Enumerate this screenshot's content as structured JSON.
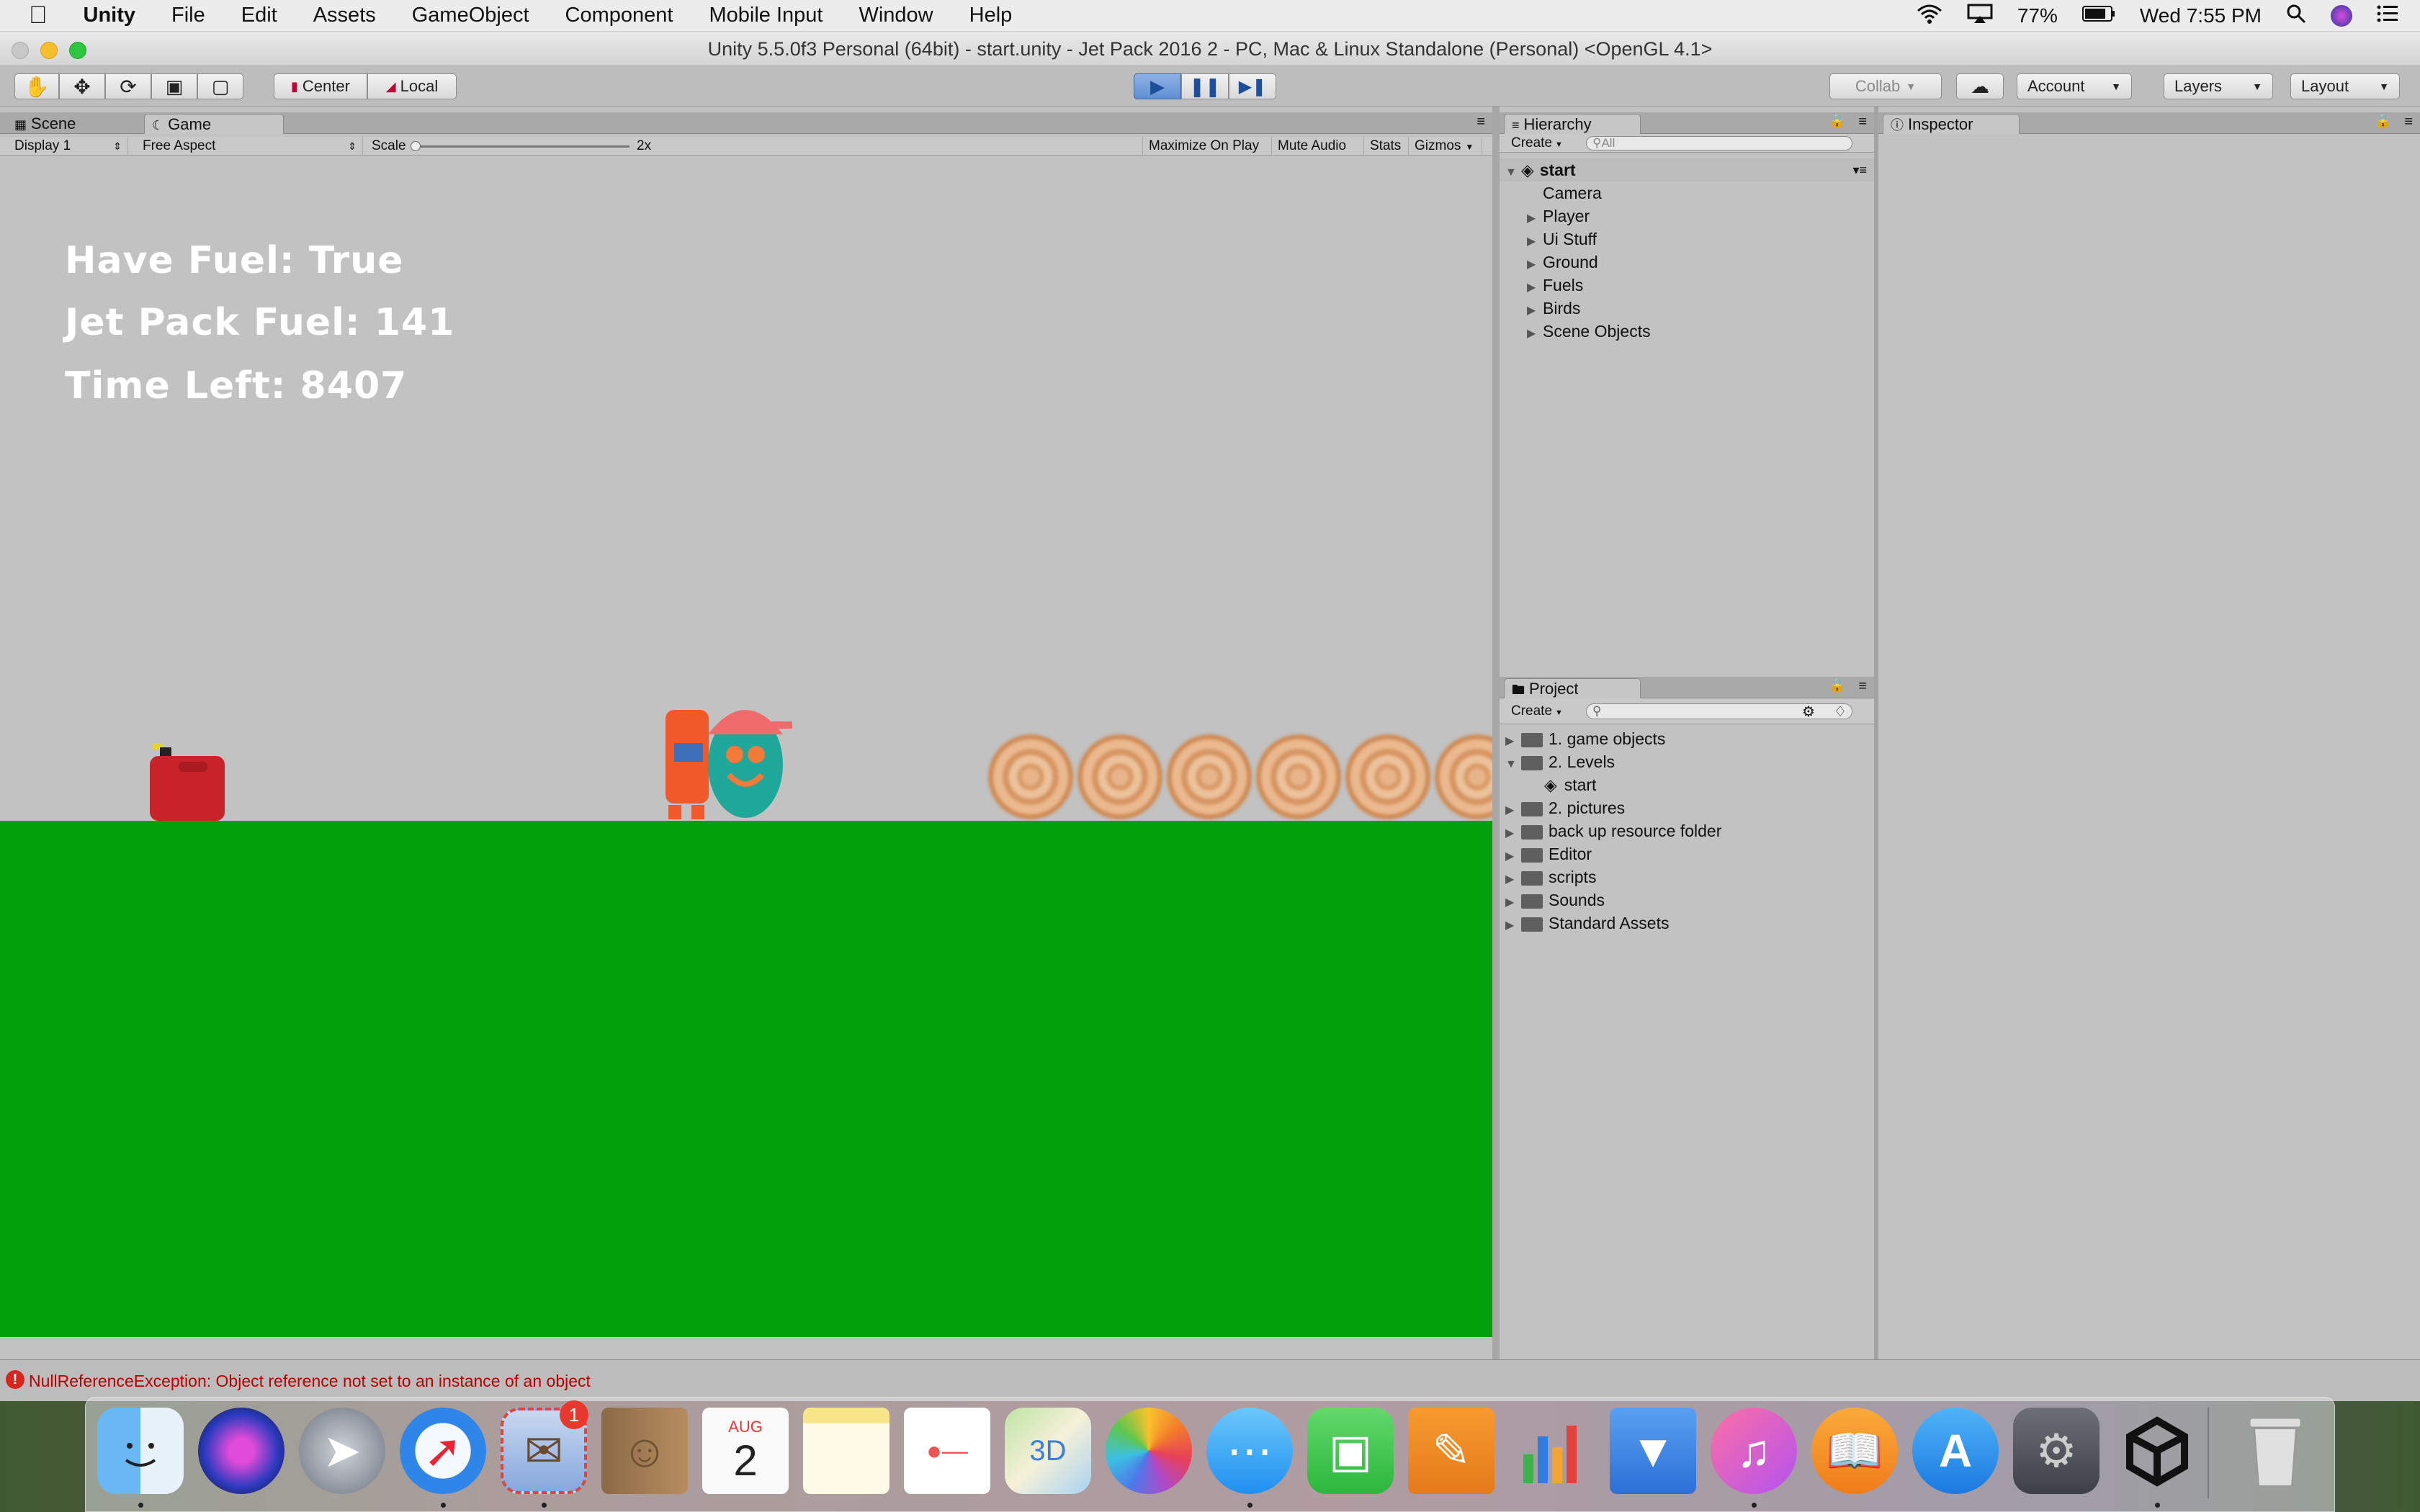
{
  "menubar": {
    "app_name": "Unity",
    "items": [
      "File",
      "Edit",
      "Assets",
      "GameObject",
      "Component",
      "Mobile Input",
      "Window",
      "Help"
    ],
    "battery": "77%",
    "clock": "Wed 7:55 PM"
  },
  "window": {
    "title": "Unity 5.5.0f3 Personal (64bit) - start.unity - Jet Pack 2016 2 - PC, Mac & Linux Standalone (Personal) <OpenGL 4.1>"
  },
  "toolbar": {
    "pivot": "Center",
    "space": "Local",
    "collab": "Collab",
    "account": "Account",
    "layers": "Layers",
    "layout": "Layout"
  },
  "game_panel": {
    "tab_scene": "Scene",
    "tab_game": "Game",
    "display": "Display 1",
    "aspect": "Free Aspect",
    "scale_label": "Scale",
    "scale_value": "2x",
    "maximize": "Maximize On Play",
    "mute": "Mute Audio",
    "stats": "Stats",
    "gizmos": "Gizmos"
  },
  "hud": {
    "fuel_status": "Have Fuel:  True",
    "jetpack_fuel": "Jet Pack Fuel:  141",
    "time_left": "Time Left: 8407"
  },
  "hierarchy": {
    "tab": "Hierarchy",
    "create": "Create",
    "search_placeholder": "All",
    "scene": "start",
    "items": [
      {
        "label": "Camera",
        "expandable": false
      },
      {
        "label": "Player",
        "expandable": true
      },
      {
        "label": "Ui Stuff",
        "expandable": true
      },
      {
        "label": "Ground",
        "expandable": true
      },
      {
        "label": "Fuels",
        "expandable": true
      },
      {
        "label": "Birds",
        "expandable": true
      },
      {
        "label": "Scene Objects",
        "expandable": true
      }
    ]
  },
  "inspector": {
    "tab": "Inspector"
  },
  "project": {
    "tab": "Project",
    "create": "Create",
    "items": [
      {
        "label": "1. game objects",
        "indent": 0,
        "open": false,
        "type": "folder"
      },
      {
        "label": "2. Levels",
        "indent": 0,
        "open": true,
        "type": "folder"
      },
      {
        "label": "start",
        "indent": 1,
        "open": false,
        "type": "scene"
      },
      {
        "label": "2. pictures",
        "indent": 0,
        "open": false,
        "type": "folder"
      },
      {
        "label": "back up resource folder",
        "indent": 0,
        "open": false,
        "type": "folder"
      },
      {
        "label": "Editor",
        "indent": 0,
        "open": false,
        "type": "folder"
      },
      {
        "label": "scripts",
        "indent": 0,
        "open": false,
        "type": "folder"
      },
      {
        "label": "Sounds",
        "indent": 0,
        "open": false,
        "type": "folder"
      },
      {
        "label": "Standard Assets",
        "indent": 0,
        "open": false,
        "type": "folder"
      }
    ]
  },
  "status": {
    "error": "NullReferenceException: Object reference not set to an instance of an object"
  },
  "dock": {
    "mail_badge": "1",
    "calendar_month": "AUG",
    "calendar_day": "2",
    "icons": [
      "finder-icon",
      "siri-icon",
      "launchpad-icon",
      "safari-icon",
      "mail-icon",
      "contacts-icon",
      "calendar-icon",
      "notes-icon",
      "reminders-icon",
      "maps-icon",
      "photos-icon",
      "messages-icon",
      "facetime-icon",
      "pages-icon",
      "numbers-icon",
      "keynote-icon",
      "itunes-icon",
      "ibooks-icon",
      "app-store-icon",
      "system-preferences-icon",
      "unity-icon",
      "trash-icon"
    ]
  }
}
